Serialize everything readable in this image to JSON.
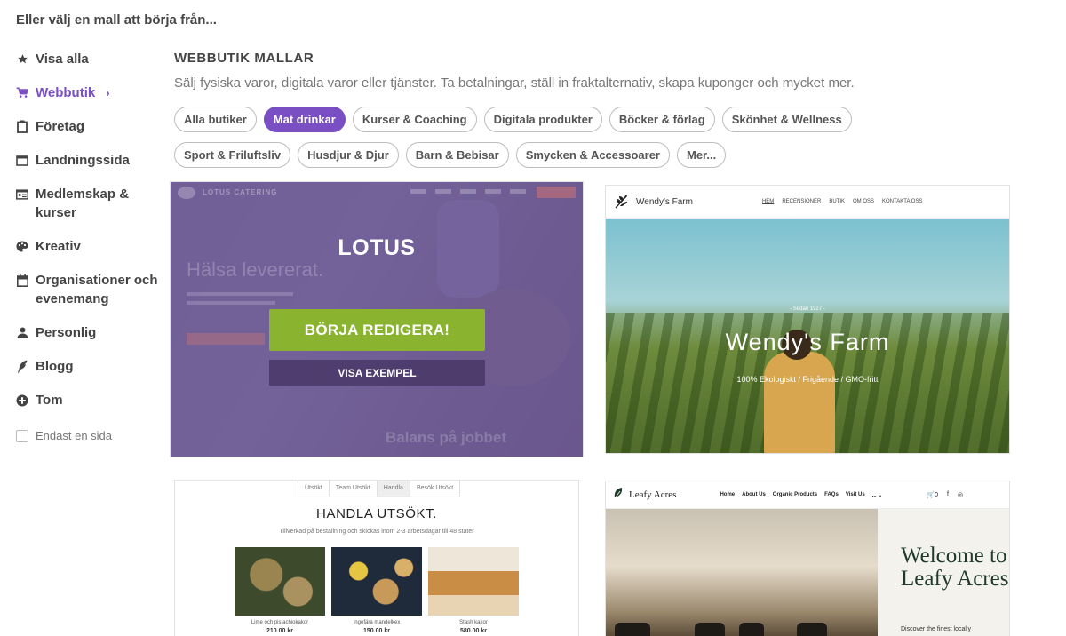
{
  "page": {
    "heading": "Eller välj en mall att börja från..."
  },
  "sidebar": {
    "items": [
      {
        "label": "Visa alla",
        "icon": "star-icon"
      },
      {
        "label": "Webbutik",
        "icon": "cart-icon",
        "active": true
      },
      {
        "label": "Företag",
        "icon": "clipboard-icon"
      },
      {
        "label": "Landningssida",
        "icon": "window-icon"
      },
      {
        "label": "Medlemskap & kurser",
        "icon": "id-card-icon"
      },
      {
        "label": "Kreativ",
        "icon": "palette-icon"
      },
      {
        "label": "Organisationer och evenemang",
        "icon": "calendar-icon"
      },
      {
        "label": "Personlig",
        "icon": "person-icon"
      },
      {
        "label": "Blogg",
        "icon": "quill-icon"
      },
      {
        "label": "Tom",
        "icon": "plus-circle-icon"
      }
    ],
    "only_page_label": "Endast en sida"
  },
  "section": {
    "title": "WEBBUTIK MALLAR",
    "subtitle": "Sälj fysiska varor, digitala varor eller tjänster. Ta betalningar, ställ in fraktalternativ, skapa kuponger och mycket mer."
  },
  "filters": [
    {
      "label": "Alla butiker"
    },
    {
      "label": "Mat drinkar",
      "active": true
    },
    {
      "label": "Kurser & Coaching"
    },
    {
      "label": "Digitala produkter"
    },
    {
      "label": "Böcker & förlag"
    },
    {
      "label": "Skönhet & Wellness"
    },
    {
      "label": "Sport & Friluftsliv"
    },
    {
      "label": "Husdjur & Djur"
    },
    {
      "label": "Barn & Bebisar"
    },
    {
      "label": "Smycken & Accessoarer"
    },
    {
      "label": "Mer..."
    }
  ],
  "templates": {
    "lotus": {
      "name": "LOTUS",
      "edit_label": "BÖRJA REDIGERA!",
      "demo_label": "VISA EXEMPEL",
      "ghost_brand": "LOTUS CATERING",
      "ghost_heading": "Hälsa levererat.",
      "ghost_footer": "Balans på jobbet"
    },
    "wendy": {
      "brand": "Wendy's  Farm",
      "nav": [
        "HEM",
        "RECENSIONER",
        "BUTIK",
        "OM OSS",
        "KONTAKTA OSS"
      ],
      "since": "- Sedan 1927 -",
      "title": "Wendy's  Farm",
      "tagline": "100% Ekologiskt / Frigående / GMO-fritt"
    },
    "handla": {
      "tabs": [
        "Utsökt",
        "Team Utsökt",
        "Handla",
        "Besök Utsökt"
      ],
      "title": "HANDLA UTSÖKT.",
      "subtitle": "Tillverkad på beställning och skickas inom 2-3 arbetsdagar till 48 stater",
      "products": [
        {
          "name": "Lime och pistachiokakor",
          "price": "210.00 kr"
        },
        {
          "name": "Ingefära mandelkex",
          "price": "150.00 kr"
        },
        {
          "name": "Stash kakor",
          "price": "580.00 kr"
        }
      ]
    },
    "leafy": {
      "brand": "Leafy Acres",
      "nav": [
        "Home",
        "About Us",
        "Organic Products",
        "FAQs",
        "Visit Us",
        "... ⌄"
      ],
      "cart": "0",
      "welcome": "Welcome to Leafy Acres",
      "discover": "Discover the finest locally"
    }
  },
  "colors": {
    "accent": "#7b4fc4",
    "edit_button": "#8ab32f",
    "overlay": "#625091"
  }
}
